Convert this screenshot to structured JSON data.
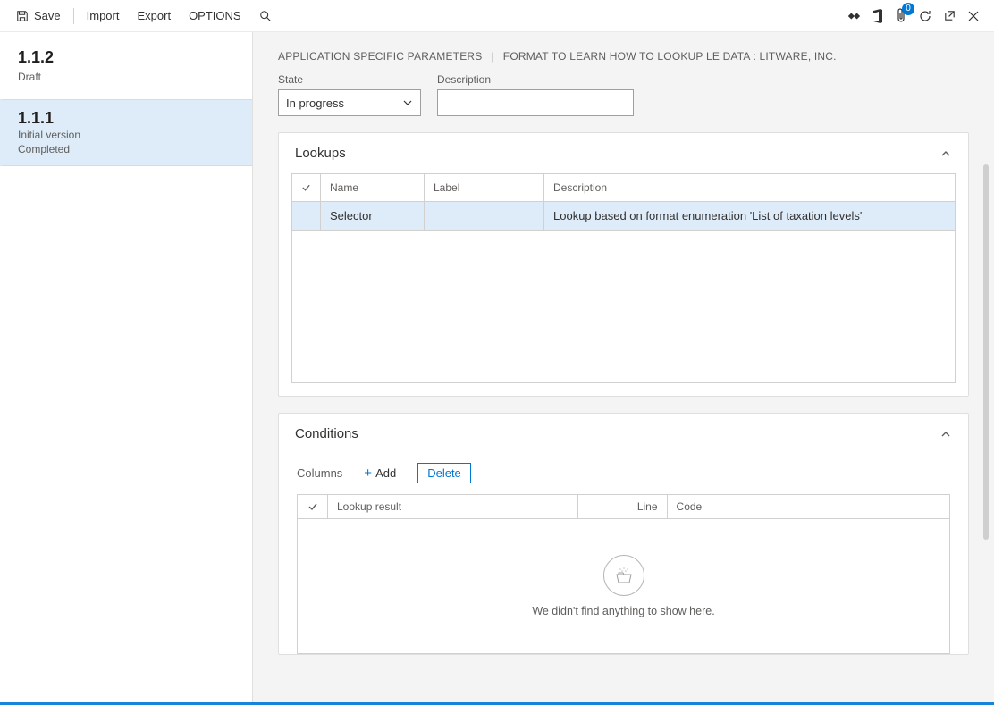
{
  "commandbar": {
    "save": "Save",
    "import": "Import",
    "export": "Export",
    "options": "OPTIONS",
    "badge_count": "0"
  },
  "sidebar": {
    "top": {
      "version": "1.1.2",
      "status": "Draft"
    },
    "selected": {
      "version": "1.1.1",
      "line1": "Initial version",
      "line2": "Completed"
    }
  },
  "header": {
    "crumb1": "APPLICATION SPECIFIC PARAMETERS",
    "crumb2": "FORMAT TO LEARN HOW TO LOOKUP LE DATA : LITWARE, INC."
  },
  "fields": {
    "state_label": "State",
    "state_value": "In progress",
    "description_label": "Description",
    "description_value": ""
  },
  "lookups": {
    "title": "Lookups",
    "columns": {
      "name": "Name",
      "label": "Label",
      "description": "Description"
    },
    "rows": [
      {
        "name": "Selector",
        "label": "",
        "description": "Lookup based on format enumeration 'List of taxation levels'"
      }
    ]
  },
  "conditions": {
    "title": "Conditions",
    "tools": {
      "columns": "Columns",
      "add": "Add",
      "delete": "Delete"
    },
    "columns": {
      "result": "Lookup result",
      "line": "Line",
      "code": "Code"
    },
    "empty_text": "We didn't find anything to show here."
  }
}
